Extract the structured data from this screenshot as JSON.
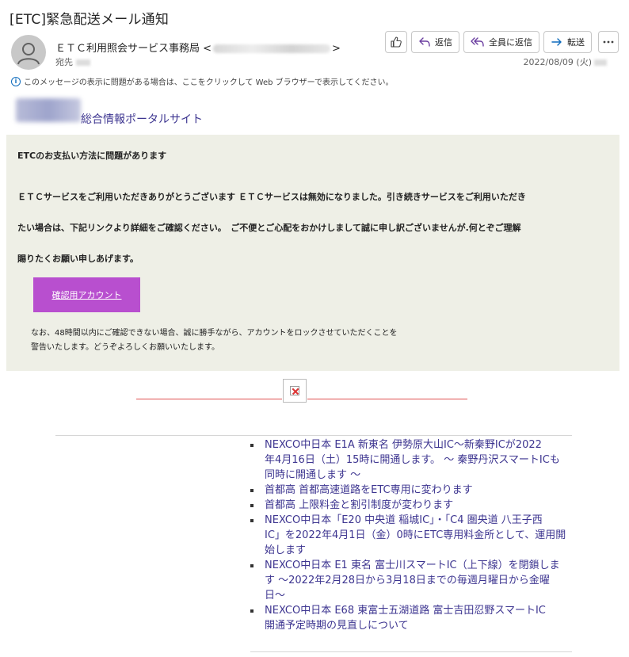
{
  "email": {
    "subject": "[ETC]緊急配送メール通知",
    "sender_name": "ＥＴＣ利用照会サービス事務局 <",
    "sender_close": ">",
    "to_label": "宛先",
    "date": "2022/08/09 (火)",
    "info_message": "このメッセージの表示に問題がある場合は、ここをクリックして Web ブラウザーで表示してください。"
  },
  "actions": {
    "reply": "返信",
    "reply_all": "全員に返信",
    "forward": "転送"
  },
  "body": {
    "portal_title": "総合情報ポータルサイト",
    "heading": "ETCのお支払い方法に問題があります",
    "paragraph_lines": [
      "ＥＴＣサービスをご利用いただきありがとうございます ＥＴＣサービスは無効になりました。引き続きサービスをご利用いただき",
      "たい場合は、下記リンクより詳細をご確認ください。　ご不便とご心配をおかけしまして誠に申し訳ございませんが.何とぞご理解",
      "賜りたくお願い申しあげます。"
    ],
    "button_label": "確認用アカウント",
    "note_lines": [
      "なお、48時間以内にご確認できない場合、誠に勝手ながら、アカウントをロックさせていただくことを",
      "警告いたします。どうぞよろしくお願いいたします。"
    ]
  },
  "news": [
    {
      "line1": "NEXCO中日本 E1A 新東名 伊勢原大山IC～新秦野ICが2022",
      "line2": "年4月16日（土）15時に開通します。 ～ 秦野丹沢スマートICも",
      "line3": "同時に開通します ～"
    },
    {
      "line1": "首都高 首都高速道路をETC専用に変わります"
    },
    {
      "line1": "首都高 上限料金と割引制度が変わります"
    },
    {
      "line1": "NEXCO中日本「E20 中央道 稲城IC」・「C4 圏央道 八王子西",
      "line2": "IC」を2022年4月1日（金）0時にETC専用料金所として、運用開",
      "line3": "始します"
    },
    {
      "line1": "NEXCO中日本 E1 東名 富士川スマートIC（上下線）を閉鎖しま",
      "line2": "す ～2022年2月28日から3月18日までの毎週月曜日から金曜",
      "line3": "日～"
    },
    {
      "line1": "NEXCO中日本 E68 東富士五湖道路 富士吉田忍野スマートIC",
      "line2": "開通予定時期の見直しについて"
    }
  ]
}
